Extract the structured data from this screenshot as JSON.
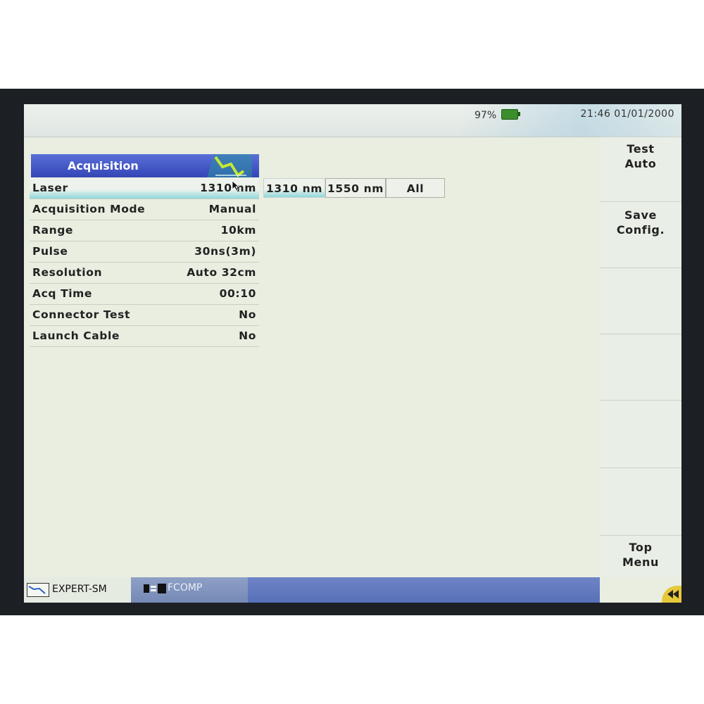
{
  "status": {
    "battery": "97%",
    "clock": "21:46  01/01/2000"
  },
  "acquisition": {
    "title": "Acquisition",
    "params": [
      {
        "label": "Laser",
        "value": "1310 nm"
      },
      {
        "label": "Acquisition Mode",
        "value": "Manual"
      },
      {
        "label": "Range",
        "value": "10km"
      },
      {
        "label": "Pulse",
        "value": "30ns(3m)"
      },
      {
        "label": "Resolution",
        "value": "Auto 32cm"
      },
      {
        "label": "Acq Time",
        "value": "00:10"
      },
      {
        "label": "Connector Test",
        "value": "No"
      },
      {
        "label": "Launch Cable",
        "value": "No"
      }
    ]
  },
  "laser_options": [
    "1310 nm",
    "1550 nm",
    "All"
  ],
  "softkeys": [
    {
      "line1": "Test",
      "line2": "Auto"
    },
    {
      "line1": "Save",
      "line2": "Config."
    },
    {
      "line1": "",
      "line2": ""
    },
    {
      "line1": "",
      "line2": ""
    },
    {
      "line1": "",
      "line2": ""
    },
    {
      "line1": "",
      "line2": ""
    },
    {
      "line1": "Top",
      "line2": "Menu"
    }
  ],
  "taskbar": {
    "expert": "EXPERT-SM",
    "fcomp": "FCOMP"
  },
  "colors": {
    "header_blue": "#3f52c4",
    "selection_cyan": "#8fd8dc",
    "battery_green": "#3a8f2c",
    "back_button": "#e7c83a"
  },
  "icons": {
    "trace": "otdr-trace-icon",
    "battery": "battery-icon",
    "cursor": "mouse-pointer-icon",
    "back": "back-arrows-icon"
  }
}
